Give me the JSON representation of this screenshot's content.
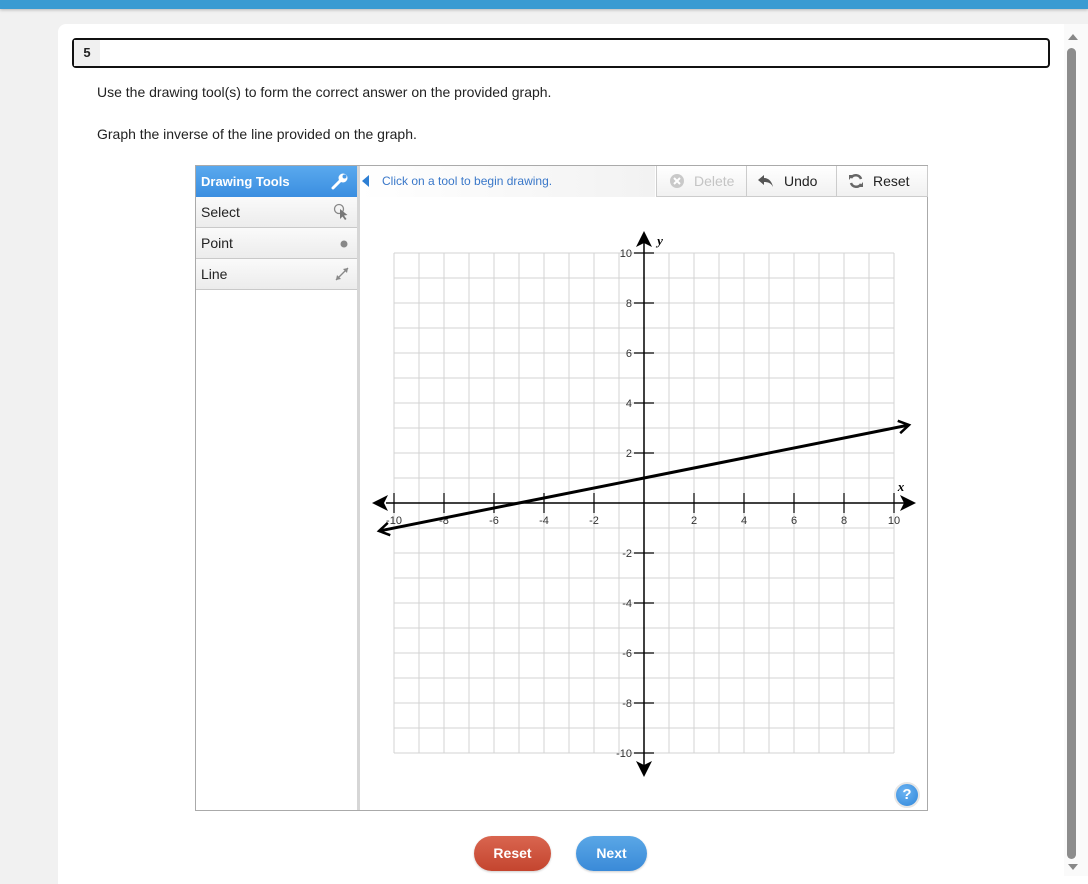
{
  "question": {
    "number": "5",
    "instruction_1": "Use the drawing tool(s) to form the correct answer on the provided graph.",
    "instruction_2": "Graph the inverse of the line provided on the graph."
  },
  "drawing_tools": {
    "header": "Drawing Tools",
    "header_icon": "wrench-icon",
    "items": [
      {
        "label": "Select",
        "icon": "select-pointer-icon"
      },
      {
        "label": "Point",
        "icon": "point-icon"
      },
      {
        "label": "Line",
        "icon": "line-icon"
      }
    ]
  },
  "toolbar": {
    "hint": "Click on a tool to begin drawing.",
    "delete_label": "Delete",
    "undo_label": "Undo",
    "reset_label": "Reset",
    "delete_enabled": false
  },
  "graph": {
    "x_axis_label": "x",
    "y_axis_label": "y",
    "xlim": [
      -10,
      10
    ],
    "ylim": [
      -10,
      10
    ],
    "grid_step": 1,
    "tick_step": 2,
    "x_tick_labels": [
      "-10",
      "-8",
      "-6",
      "-4",
      "-2",
      "2",
      "4",
      "6",
      "8",
      "10"
    ],
    "y_tick_labels": [
      "10",
      "8",
      "6",
      "4",
      "2",
      "-2",
      "-4",
      "-6",
      "-8",
      "-10"
    ],
    "given_line": {
      "slope": 0.2,
      "intercept": 1,
      "points": [
        [
          -10,
          -1
        ],
        [
          0,
          1
        ],
        [
          10,
          3
        ]
      ],
      "color": "#000000"
    }
  },
  "help_label": "?",
  "footer": {
    "reset_label": "Reset",
    "next_label": "Next"
  },
  "colors": {
    "topbar": "#3a9bd2",
    "tool_header": "#3b8ee0",
    "reset_button": "#c4452f",
    "next_button": "#3a8ad8",
    "hint_text": "#3a78c9"
  }
}
